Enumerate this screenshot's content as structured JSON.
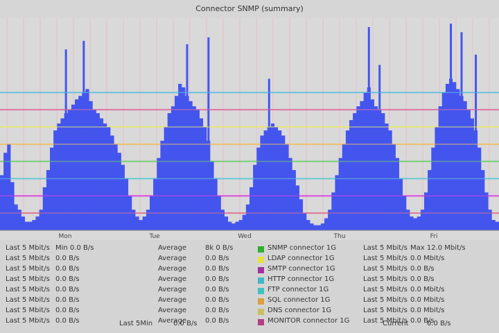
{
  "title": "Connector SNMP (summary)",
  "chart_data": {
    "type": "area",
    "x_tick_labels": [
      "Mon",
      "Tue",
      "Wed",
      "Thu",
      "Fri"
    ],
    "ylim": [
      0,
      12
    ],
    "grid": true,
    "ref_lines": [
      {
        "value": 1.0,
        "color": "#e07090"
      },
      {
        "value": 2.0,
        "color": "#e040e0"
      },
      {
        "value": 3.0,
        "color": "#60c8d8"
      },
      {
        "value": 4.0,
        "color": "#70d070"
      },
      {
        "value": 5.0,
        "color": "#f0c060"
      },
      {
        "value": 6.0,
        "color": "#e8e870"
      },
      {
        "value": 7.0,
        "color": "#e070a0"
      },
      {
        "value": 8.0,
        "color": "#60c0e0"
      }
    ],
    "series": [
      {
        "color": "#4455ee",
        "values": [
          3.2,
          4.5,
          5.0,
          2.8,
          1.5,
          1.2,
          0.8,
          0.5,
          0.5,
          0.6,
          0.8,
          1.2,
          2.5,
          3.5,
          4.8,
          5.8,
          6.2,
          6.5,
          6.8,
          7.0,
          7.3,
          7.6,
          7.8,
          8.0,
          8.2,
          7.5,
          7.0,
          6.8,
          6.5,
          6.2,
          6.0,
          5.5,
          5.0,
          4.5,
          3.8,
          3.0,
          2.0,
          1.2,
          0.8,
          0.6,
          0.8,
          1.2,
          2.0,
          3.0,
          4.2,
          5.2,
          6.0,
          6.8,
          7.2,
          7.8,
          8.5,
          8.3,
          7.8,
          7.5,
          7.2,
          7.0,
          6.5,
          6.0,
          5.2,
          4.0,
          3.0,
          2.0,
          1.2,
          0.8,
          0.5,
          0.4,
          0.5,
          0.6,
          0.9,
          1.5,
          2.5,
          3.8,
          4.8,
          5.5,
          5.8,
          6.0,
          6.2,
          6.0,
          5.8,
          5.5,
          5.0,
          4.2,
          3.5,
          2.6,
          1.8,
          1.0,
          0.6,
          0.4,
          0.3,
          0.3,
          0.4,
          0.7,
          1.2,
          2.2,
          3.2,
          4.2,
          5.0,
          5.8,
          6.4,
          6.8,
          7.2,
          7.5,
          8.0,
          8.3,
          7.6,
          7.2,
          7.0,
          6.8,
          6.2,
          5.8,
          5.0,
          4.2,
          3.0,
          2.0,
          1.2,
          0.8,
          0.7,
          0.8,
          1.2,
          2.2,
          3.5,
          4.8,
          6.0,
          7.2,
          8.0,
          8.5,
          8.8,
          8.6,
          8.2,
          7.8,
          7.5,
          7.0,
          6.5,
          5.8,
          4.8,
          3.5,
          2.2,
          1.2,
          0.6,
          0.5
        ],
        "spikes": [
          {
            "i": 18,
            "v": 10.5
          },
          {
            "i": 23,
            "v": 11.0
          },
          {
            "i": 52,
            "v": 10.8
          },
          {
            "i": 58,
            "v": 11.2
          },
          {
            "i": 75,
            "v": 8.8
          },
          {
            "i": 103,
            "v": 11.8
          },
          {
            "i": 106,
            "v": 9.6
          },
          {
            "i": 126,
            "v": 12.0
          },
          {
            "i": 129,
            "v": 11.5
          },
          {
            "i": 133,
            "v": 10.2
          }
        ]
      }
    ]
  },
  "legend_rows": [
    {
      "c1": "Last 5 Mbit/s",
      "c2": "Min 0.0 B/s",
      "c3": "Average",
      "c4": "8k 0 B/s",
      "label": "SNMP connector 1G",
      "color": "#30b030",
      "c5": "Last 5 Mbit/s",
      "c6": "Max 12.0 Mbit/s"
    },
    {
      "c1": "Last 5 Mbit/s",
      "c2": "0.0 B/s",
      "c3": "Average",
      "c4": "0.0 B/s",
      "label": "LDAP connector 1G",
      "color": "#e8e040",
      "c5": "Last 5 Mbit/s",
      "c6": "0.0 Mbit/s"
    },
    {
      "c1": "Last 5 Mbit/s",
      "c2": "0.0 B/s",
      "c3": "Average",
      "c4": "0.0 B/s",
      "label": "SMTP connector 1G",
      "color": "#a030a0",
      "c5": "Last 5 Mbit/s",
      "c6": "0.0 B/s"
    },
    {
      "c1": "Last 5 Mbit/s",
      "c2": "0.0 B/s",
      "c3": "Average",
      "c4": "0.0 B/s",
      "label": "HTTP connector 1G",
      "color": "#40b8c8",
      "c5": "Last 5 Mbit/s",
      "c6": "0.0 B/s"
    },
    {
      "c1": "Last 5 Mbit/s",
      "c2": "0.0 B/s",
      "c3": "Average",
      "c4": "0.0 B/s",
      "label": "FTP connector 1G",
      "color": "#40c0c0",
      "c5": "Last 5 Mbit/s",
      "c6": "0.0 Mbit/s"
    },
    {
      "c1": "Last 5 Mbit/s",
      "c2": "0.0 B/s",
      "c3": "Average",
      "c4": "0.0 B/s",
      "label": "SQL connector 1G",
      "color": "#d8a040",
      "c5": "Last 5 Mbit/s",
      "c6": "0.0 Mbit/s"
    },
    {
      "c1": "Last 5 Mbit/s",
      "c2": "0.0 B/s",
      "c3": "Average",
      "c4": "0.0 B/s",
      "label": "DNS connector 1G",
      "color": "#c8c060",
      "c5": "Last 5 Mbit/s",
      "c6": "0.0 Mbit/s"
    },
    {
      "c1": "Last 5 Mbit/s",
      "c2": "0.0 B/s",
      "c3": "Average",
      "c4": "0.0 B/s",
      "label": "MONITOR connector 1G",
      "color": "#b04080",
      "c5": "Last 5 Mbit/s",
      "c6": "0.0 B/s"
    }
  ],
  "footer": {
    "left_label": "Last 5Min",
    "left_value": "0.0 B/s",
    "right_label": "Current",
    "right_value": "0.0 B/s"
  }
}
